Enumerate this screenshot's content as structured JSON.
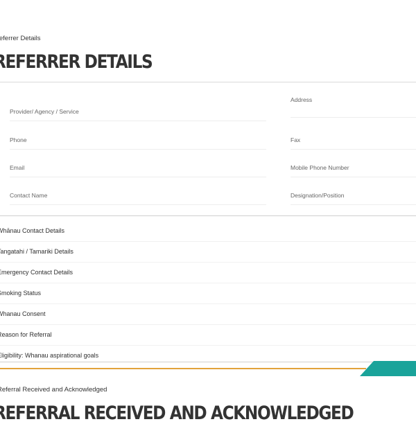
{
  "breadcrumb": "Referrer Details",
  "title": "REFERRER DETAILS",
  "form": {
    "left_fields": [
      {
        "label": "Provider/ Agency / Service",
        "value": ""
      },
      {
        "label": "Phone",
        "value": ""
      },
      {
        "label": "Email",
        "value": ""
      },
      {
        "label": "Contact Name",
        "value": ""
      }
    ],
    "right_fields": [
      {
        "label": "Address",
        "value": ""
      },
      {
        "label": "Fax",
        "value": ""
      },
      {
        "label": "Mobile Phone Number",
        "value": ""
      },
      {
        "label": "Designation/Position",
        "value": ""
      }
    ]
  },
  "sections": [
    "Whānau Contact Details",
    "Tangatahi / Tamariki Details",
    "Emergency Contact Details",
    "Smoking Status",
    "Whanau Consent",
    "Reason for Referral",
    "Eligibility: Whanau aspirational goals"
  ],
  "next_section": {
    "breadcrumb": "Referral Received and Acknowledged",
    "title": "REFERRAL RECEIVED AND ACKNOWLEDGED"
  },
  "colors": {
    "accent_gold": "#e2a23b",
    "accent_teal": "#1aa39a"
  }
}
